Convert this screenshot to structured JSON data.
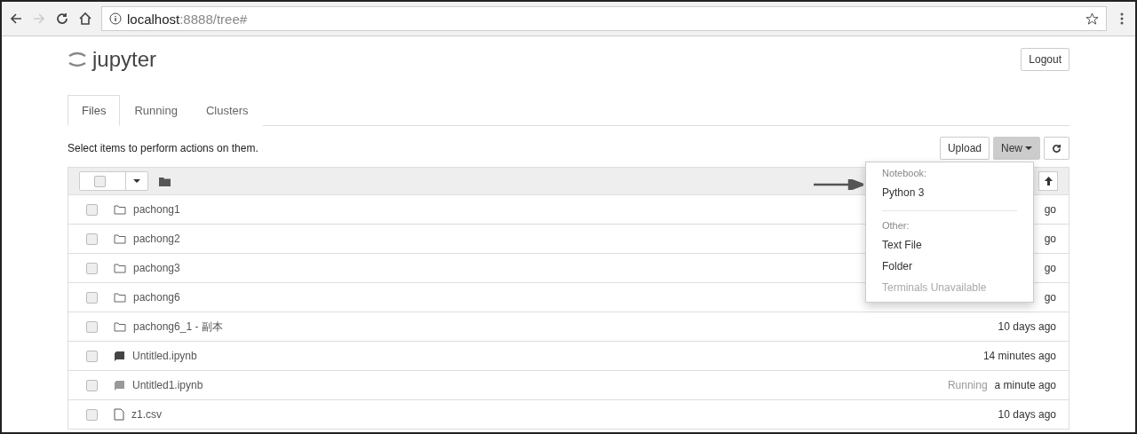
{
  "browser": {
    "url_host": "localhost",
    "url_rest": ":8888/tree#"
  },
  "header": {
    "logo_text": "jupyter",
    "logout": "Logout"
  },
  "tabs": [
    {
      "label": "Files",
      "selected": true
    },
    {
      "label": "Running",
      "selected": false
    },
    {
      "label": "Clusters",
      "selected": false
    }
  ],
  "hint": "Select items to perform actions on them.",
  "toolbar": {
    "upload": "Upload",
    "new": "New",
    "new_open": true
  },
  "files": [
    {
      "kind": "folder",
      "name": "pachong1",
      "modified": "go",
      "checked": false
    },
    {
      "kind": "folder",
      "name": "pachong2",
      "modified": "go",
      "checked": false
    },
    {
      "kind": "folder",
      "name": "pachong3",
      "modified": "go",
      "checked": false
    },
    {
      "kind": "folder",
      "name": "pachong6",
      "modified": "go",
      "checked": false
    },
    {
      "kind": "folder",
      "name": "pachong6_1 - 副本",
      "modified": "10 days ago",
      "checked": false
    },
    {
      "kind": "notebook",
      "name": "Untitled.ipynb",
      "modified": "14 minutes ago",
      "checked": false
    },
    {
      "kind": "notebook",
      "name": "Untitled1.ipynb",
      "status": "Running",
      "modified": "a minute ago",
      "checked": false
    },
    {
      "kind": "file",
      "name": "z1.csv",
      "modified": "10 days ago",
      "checked": false
    }
  ],
  "new_menu": [
    {
      "kind": "header",
      "label": "Notebook:"
    },
    {
      "kind": "item",
      "label": "Python 3"
    },
    {
      "kind": "divider"
    },
    {
      "kind": "header",
      "label": "Other:"
    },
    {
      "kind": "item",
      "label": "Text File"
    },
    {
      "kind": "item",
      "label": "Folder"
    },
    {
      "kind": "disabled",
      "label": "Terminals Unavailable"
    }
  ]
}
